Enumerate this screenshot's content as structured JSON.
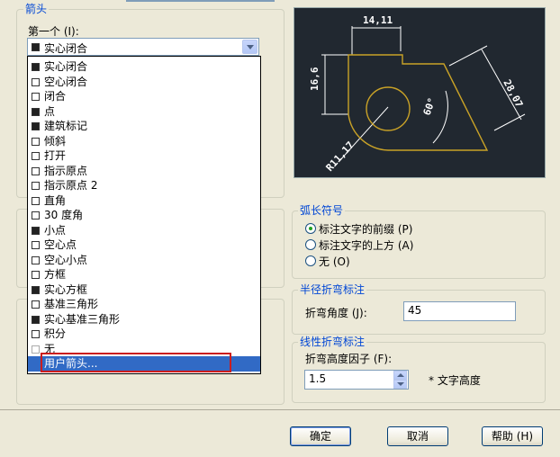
{
  "arrows": {
    "group_title": "箭头",
    "first_label": "第一个 (I):",
    "first_value": "实心闭合",
    "options": [
      "实心闭合",
      "空心闭合",
      "闭合",
      "点",
      "建筑标记",
      "倾斜",
      "打开",
      "指示原点",
      "指示原点 2",
      "直角",
      "30 度角",
      "小点",
      "空心点",
      "空心小点",
      "方框",
      "实心方框",
      "基准三角形",
      "实心基准三角形",
      "积分",
      "无",
      "用户箭头..."
    ],
    "selected_option": "用户箭头..."
  },
  "preview": {
    "dim_top": "14,11",
    "dim_left": "16,6",
    "dim_right": "28,07",
    "dim_angle": "60°",
    "dim_radius": "R11,17"
  },
  "arc_symbol": {
    "title": "弧长符号",
    "options": [
      "标注文字的前缀 (P)",
      "标注文字的上方 (A)",
      "无 (O)"
    ],
    "selected": 0
  },
  "radius_jog": {
    "title": "半径折弯标注",
    "angle_label": "折弯角度 (J):",
    "angle_value": "45"
  },
  "linear_jog": {
    "title": "线性折弯标注",
    "factor_label": "折弯高度因子 (F):",
    "factor_value": "1.5",
    "factor_suffix": "* 文字高度"
  },
  "buttons": {
    "ok": "确定",
    "cancel": "取消",
    "help": "帮助 (H)"
  }
}
